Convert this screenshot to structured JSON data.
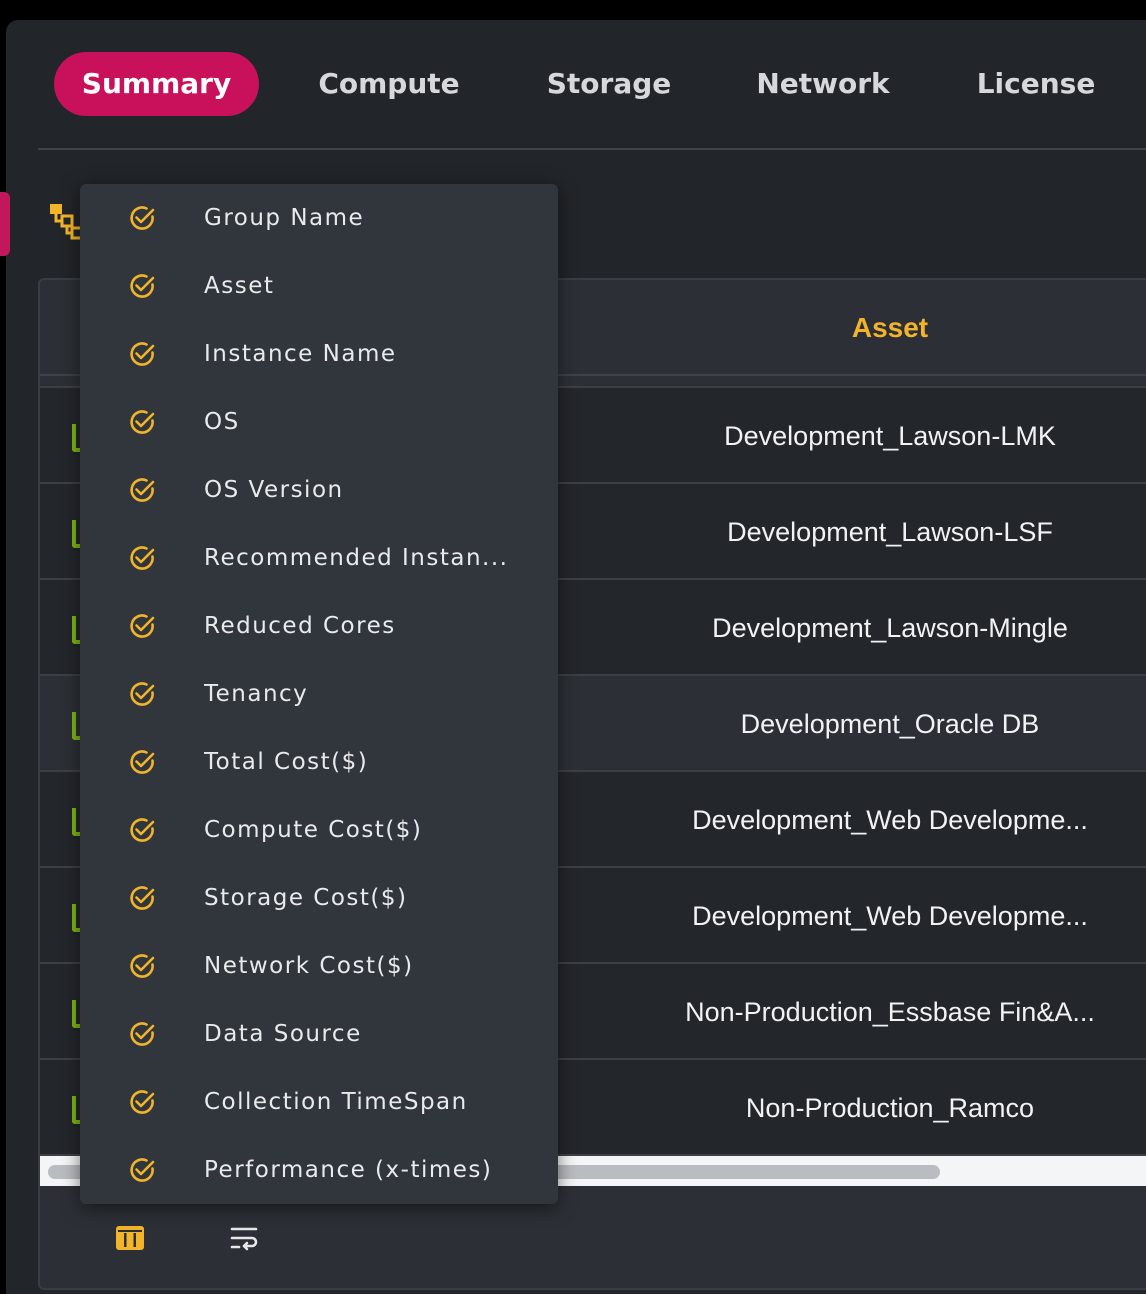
{
  "tabs": [
    {
      "label": "Summary",
      "active": true
    },
    {
      "label": "Compute",
      "active": false
    },
    {
      "label": "Storage",
      "active": false
    },
    {
      "label": "Network",
      "active": false
    },
    {
      "label": "License",
      "active": false
    }
  ],
  "table": {
    "column_header": "Asset",
    "rows": [
      {
        "asset": "Development_Lawson-LMK"
      },
      {
        "asset": "Development_Lawson-LSF"
      },
      {
        "asset": "Development_Lawson-Mingle"
      },
      {
        "asset": "Development_Oracle DB"
      },
      {
        "asset": "Development_Web Developme..."
      },
      {
        "asset": "Development_Web Developme..."
      },
      {
        "asset": "Non-Production_Essbase Fin&A..."
      },
      {
        "asset": "Non-Production_Ramco"
      }
    ]
  },
  "column_menu": {
    "items": [
      {
        "label": "Group Name",
        "checked": true
      },
      {
        "label": "Asset",
        "checked": true
      },
      {
        "label": "Instance Name",
        "checked": true
      },
      {
        "label": "OS",
        "checked": true
      },
      {
        "label": "OS Version",
        "checked": true
      },
      {
        "label": "Recommended Instan...",
        "checked": true
      },
      {
        "label": "Reduced Cores",
        "checked": true
      },
      {
        "label": "Tenancy",
        "checked": true
      },
      {
        "label": "Total Cost($)",
        "checked": true
      },
      {
        "label": "Compute Cost($)",
        "checked": true
      },
      {
        "label": "Storage Cost($)",
        "checked": true
      },
      {
        "label": "Network Cost($)",
        "checked": true
      },
      {
        "label": "Data Source",
        "checked": true
      },
      {
        "label": "Collection TimeSpan",
        "checked": true
      },
      {
        "label": "Performance (x-times)",
        "checked": true
      }
    ]
  },
  "icons": {
    "group_by": "hierarchy-icon",
    "menu_check": "check-circle-icon",
    "footer_columns": "columns-icon",
    "footer_wrap": "text-wrap-icon"
  },
  "colors": {
    "accent": "#c8115a",
    "header_text": "#f2b42a",
    "check": "#f2b42a",
    "row_check": "#7cb518"
  }
}
